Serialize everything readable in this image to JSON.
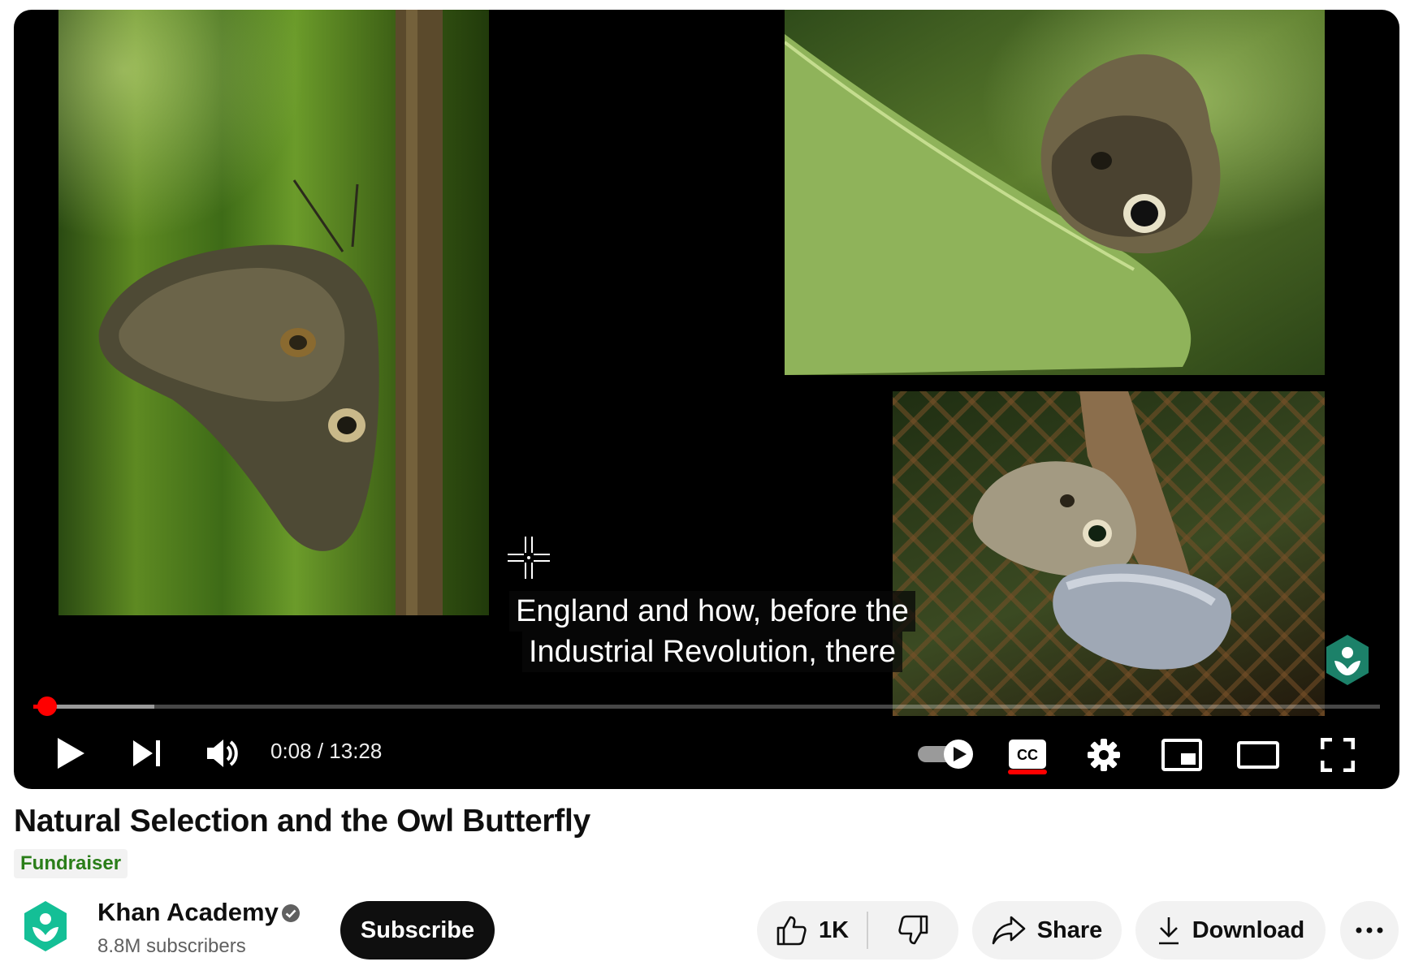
{
  "player": {
    "caption_lines": [
      "England and how, before the",
      "Industrial Revolution, there"
    ],
    "time_display": "0:08 / 13:28",
    "current_time": "0:08",
    "duration": "13:28",
    "progress_fraction": 0.01,
    "buffered_fraction": 0.09,
    "progress_color": "#ff0000",
    "autoplay_on": true,
    "captions_on": true,
    "controls": {
      "play_icon": "play-icon",
      "next_icon": "next-icon",
      "volume_icon": "volume-icon",
      "autoplay_icon": "autoplay-toggle-icon",
      "captions_label": "CC",
      "settings_icon": "gear-icon",
      "miniplayer_icon": "miniplayer-icon",
      "theater_icon": "theater-mode-icon",
      "fullscreen_icon": "fullscreen-icon"
    }
  },
  "video": {
    "title": "Natural Selection and the Owl Butterfly",
    "badge": "Fundraiser"
  },
  "channel": {
    "name": "Khan Academy",
    "verified": true,
    "subscribers": "8.8M subscribers",
    "subscribe_label": "Subscribe",
    "brand_color": "#14bf96"
  },
  "actions": {
    "like_count": "1K",
    "share_label": "Share",
    "download_label": "Download",
    "more_icon": "more-horizontal-icon"
  }
}
